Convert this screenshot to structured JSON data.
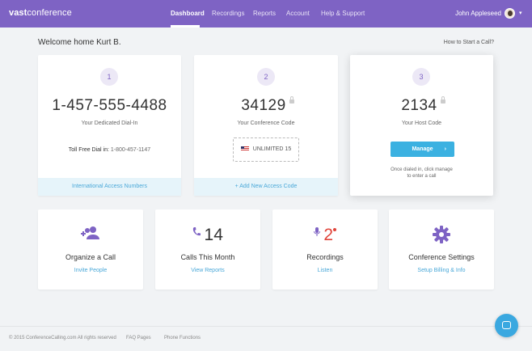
{
  "brand": {
    "name_bold": "vast",
    "name_rest": "conference"
  },
  "nav": {
    "items": [
      "Dashboard",
      "Recordings",
      "Reports",
      "Account",
      "Help & Support"
    ],
    "active_index": 0
  },
  "user": {
    "name": "John Appleseed"
  },
  "welcome": "Welcome home Kurt B.",
  "how_to": "How to Start a Call?",
  "cards": [
    {
      "step": "1",
      "number": "1-457-555-4488",
      "label": "Your Dedicated Dial-In",
      "tollfree_label": "Toll Free Dial in:",
      "tollfree_number": "1-800-457-1147",
      "footer": "International Access Numbers"
    },
    {
      "step": "2",
      "number": "34129",
      "label": "Your Conference Code",
      "plan": "UNLIMITED 15",
      "footer": "+ Add New Access Code"
    },
    {
      "step": "3",
      "number": "2134",
      "label": "Your Host Code",
      "button": "Manage",
      "hint_line1": "Once dialed in, click manage",
      "hint_line2": "to enter a call"
    }
  ],
  "features": [
    {
      "title": "Organize a Call",
      "link": "Invite People"
    },
    {
      "stat": "14",
      "title": "Calls This Month",
      "link": "View Reports"
    },
    {
      "stat": "2",
      "title": "Recordings",
      "link": "Listen"
    },
    {
      "title": "Conference Settings",
      "link": "Setup Billing & Info"
    }
  ],
  "footer": {
    "copyright": "© 2015 ConferenceCalling.com All rights reserved",
    "links": [
      "FAQ Pages",
      "Phone Functions"
    ]
  },
  "colors": {
    "primary": "#7e63c4",
    "accent_blue": "#3bb1e1",
    "alert_red": "#e0443a"
  },
  "icons": [
    "user-group-icon",
    "phone-icon",
    "microphone-icon",
    "gear-icon",
    "lock-icon",
    "us-flag-icon",
    "chat-icon"
  ]
}
